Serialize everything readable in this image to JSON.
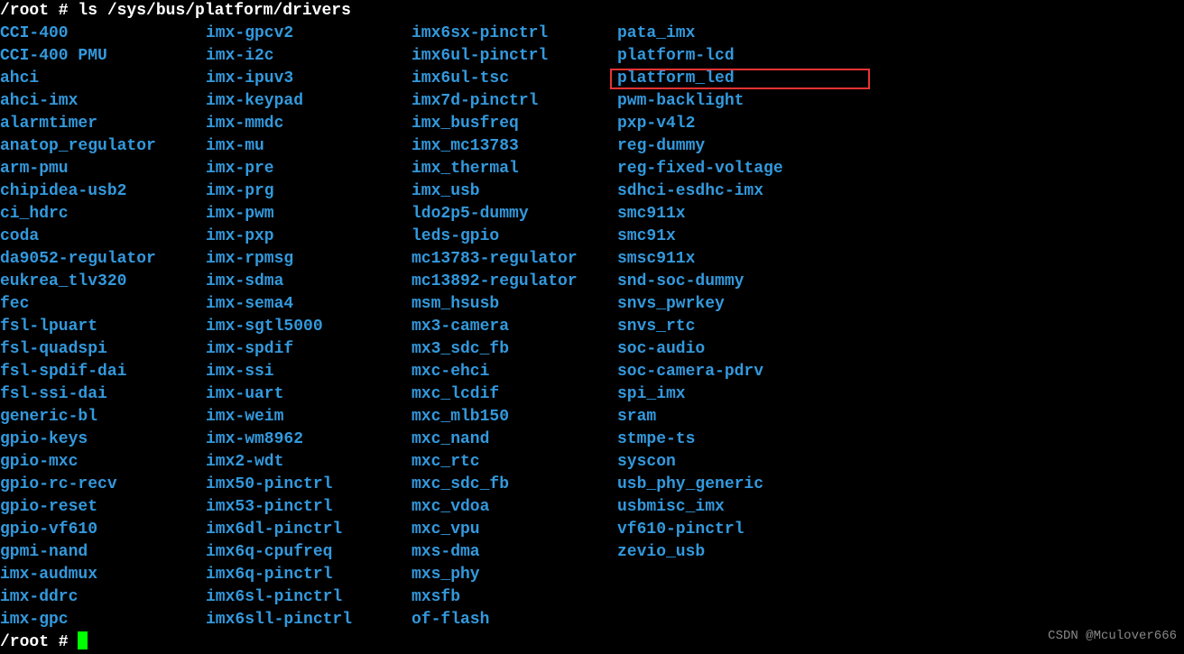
{
  "prompt": "/root # ",
  "command": "ls /sys/bus/platform/drivers",
  "prompt2": "/root # ",
  "watermark": "CSDN @Mculover666",
  "columns": [
    [
      "CCI-400",
      "CCI-400 PMU",
      "ahci",
      "ahci-imx",
      "alarmtimer",
      "anatop_regulator",
      "arm-pmu",
      "chipidea-usb2",
      "ci_hdrc",
      "coda",
      "da9052-regulator",
      "eukrea_tlv320",
      "fec",
      "fsl-lpuart",
      "fsl-quadspi",
      "fsl-spdif-dai",
      "fsl-ssi-dai",
      "generic-bl",
      "gpio-keys",
      "gpio-mxc",
      "gpio-rc-recv",
      "gpio-reset",
      "gpio-vf610",
      "gpmi-nand",
      "imx-audmux",
      "imx-ddrc",
      "imx-gpc"
    ],
    [
      "imx-gpcv2",
      "imx-i2c",
      "imx-ipuv3",
      "imx-keypad",
      "imx-mmdc",
      "imx-mu",
      "imx-pre",
      "imx-prg",
      "imx-pwm",
      "imx-pxp",
      "imx-rpmsg",
      "imx-sdma",
      "imx-sema4",
      "imx-sgtl5000",
      "imx-spdif",
      "imx-ssi",
      "imx-uart",
      "imx-weim",
      "imx-wm8962",
      "imx2-wdt",
      "imx50-pinctrl",
      "imx53-pinctrl",
      "imx6dl-pinctrl",
      "imx6q-cpufreq",
      "imx6q-pinctrl",
      "imx6sl-pinctrl",
      "imx6sll-pinctrl"
    ],
    [
      "imx6sx-pinctrl",
      "imx6ul-pinctrl",
      "imx6ul-tsc",
      "imx7d-pinctrl",
      "imx_busfreq",
      "imx_mc13783",
      "imx_thermal",
      "imx_usb",
      "ldo2p5-dummy",
      "leds-gpio",
      "mc13783-regulator",
      "mc13892-regulator",
      "msm_hsusb",
      "mx3-camera",
      "mx3_sdc_fb",
      "mxc-ehci",
      "mxc_lcdif",
      "mxc_mlb150",
      "mxc_nand",
      "mxc_rtc",
      "mxc_sdc_fb",
      "mxc_vdoa",
      "mxc_vpu",
      "mxs-dma",
      "mxs_phy",
      "mxsfb",
      "of-flash"
    ],
    [
      "pata_imx",
      "platform-lcd",
      "platform_led",
      "pwm-backlight",
      "pxp-v4l2",
      "reg-dummy",
      "reg-fixed-voltage",
      "sdhci-esdhc-imx",
      "smc911x",
      "smc91x",
      "smsc911x",
      "snd-soc-dummy",
      "snvs_pwrkey",
      "snvs_rtc",
      "soc-audio",
      "soc-camera-pdrv",
      "spi_imx",
      "sram",
      "stmpe-ts",
      "syscon",
      "usb_phy_generic",
      "usbmisc_imx",
      "vf610-pinctrl",
      "zevio_usb"
    ]
  ]
}
